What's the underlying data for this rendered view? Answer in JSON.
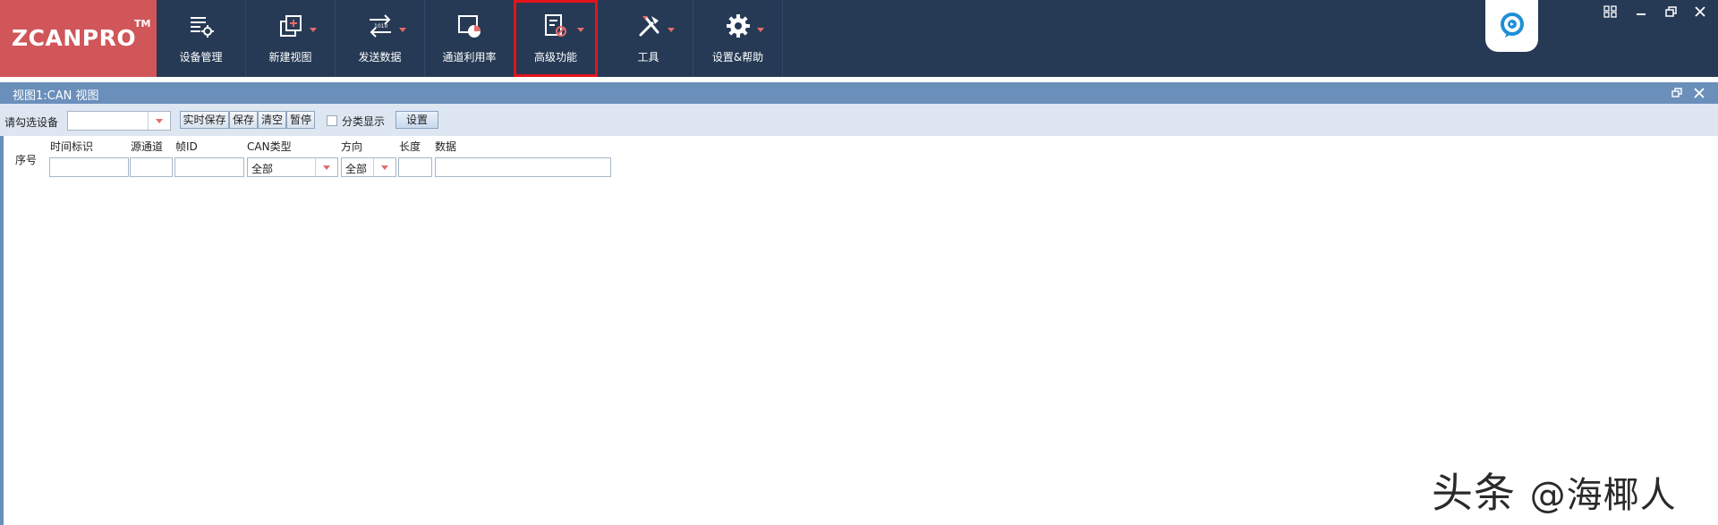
{
  "app": {
    "logo_text": "ZCANPRO",
    "logo_tm": "TM"
  },
  "ribbon": {
    "tools": [
      {
        "label": "设备管理",
        "icon": "device-manage-icon",
        "has_dropdown": false
      },
      {
        "label": "新建视图",
        "icon": "new-view-icon",
        "has_dropdown": true
      },
      {
        "label": "发送数据",
        "icon": "send-data-icon",
        "has_dropdown": true
      },
      {
        "label": "通道利用率",
        "icon": "channel-usage-icon",
        "has_dropdown": false
      },
      {
        "label": "高级功能",
        "icon": "advanced-icon",
        "has_dropdown": true,
        "highlighted": true
      },
      {
        "label": "工具",
        "icon": "tools-icon",
        "has_dropdown": true
      },
      {
        "label": "设置&帮助",
        "icon": "gear-icon",
        "has_dropdown": true
      }
    ],
    "help_icon": "chat-help-icon",
    "window_controls": [
      "layout-icon",
      "minimize-icon",
      "restore-icon",
      "close-icon"
    ]
  },
  "view": {
    "title": "视图1:CAN 视图",
    "controls": [
      "restore-icon",
      "close-icon"
    ]
  },
  "toolbar": {
    "device_label": "请勾选设备",
    "device_value": "",
    "buttons": [
      "实时保存",
      "保存",
      "清空",
      "暂停"
    ],
    "classify_label": "分类显示",
    "classify_checked": false,
    "settings_label": "设置"
  },
  "table": {
    "seq_label": "序号",
    "columns": [
      {
        "label": "时间标识",
        "filter": ""
      },
      {
        "label": "源通道",
        "filter": ""
      },
      {
        "label": "帧ID",
        "filter": ""
      },
      {
        "label": "CAN类型",
        "filter": "全部"
      },
      {
        "label": "方向",
        "filter": "全部"
      },
      {
        "label": "长度",
        "filter": ""
      },
      {
        "label": "数据",
        "filter": ""
      }
    ]
  },
  "watermark": {
    "text_a": "头条",
    "text_b": "@海椰人"
  },
  "colors": {
    "ribbon_bg": "#263a55",
    "logo_bg": "#d05659",
    "view_titlebar": "#6a8fbb",
    "toolbar_bg": "#dde6f1",
    "highlight_border": "#e3131b",
    "dropdown_arrow": "#e56b6b"
  }
}
